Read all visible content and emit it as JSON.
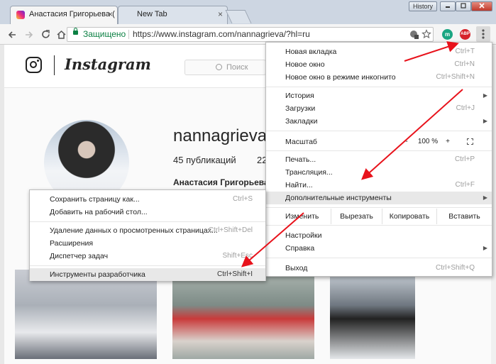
{
  "browser": {
    "tabs": [
      {
        "label": "Анастасия Григорьева (",
        "close": "×"
      },
      {
        "label": "New Tab",
        "close": "×"
      }
    ],
    "window_buttons": {
      "history": "History"
    },
    "address": {
      "secure_label": "Защищено",
      "url": "https://www.instagram.com/nannagrieva/?hl=ru"
    },
    "extensions": [
      {
        "name": "m-icon",
        "text": "m",
        "color": "#1aa682"
      },
      {
        "name": "adblock-icon",
        "text": "ABP",
        "color": "#d6222a"
      }
    ]
  },
  "instagram": {
    "wordmark": "Instagram",
    "search_placeholder": "Поиск",
    "username": "nannagrieva",
    "posts": "45 публикаций",
    "followers_partial": "22",
    "full_name": "Анастасия Григорьева"
  },
  "chrome_menu": {
    "items_top": [
      {
        "label": "Новая вкладка",
        "shortcut": "Ctrl+T"
      },
      {
        "label": "Новое окно",
        "shortcut": "Ctrl+N"
      },
      {
        "label": "Новое окно в режиме инкогнито",
        "shortcut": "Ctrl+Shift+N"
      }
    ],
    "items_history": [
      {
        "label": "История",
        "arrow": "▶"
      },
      {
        "label": "Загрузки",
        "shortcut": "Ctrl+J"
      },
      {
        "label": "Закладки",
        "arrow": "▶"
      }
    ],
    "zoom": {
      "label": "Масштаб",
      "minus": "-",
      "value": "100 %",
      "plus": "+"
    },
    "items_tools": [
      {
        "label": "Печать...",
        "shortcut": "Ctrl+P"
      },
      {
        "label": "Трансляция..."
      },
      {
        "label": "Найти...",
        "shortcut": "Ctrl+F"
      },
      {
        "label": "Дополнительные инструменты",
        "arrow": "▶"
      }
    ],
    "edit": {
      "label": "Изменить",
      "cut": "Вырезать",
      "copy": "Копировать",
      "paste": "Вставить"
    },
    "items_bottom": [
      {
        "label": "Настройки"
      },
      {
        "label": "Справка",
        "arrow": "▶"
      }
    ],
    "exit": {
      "label": "Выход",
      "shortcut": "Ctrl+Shift+Q"
    }
  },
  "submenu": {
    "group1": [
      {
        "label": "Сохранить страницу как...",
        "shortcut": "Ctrl+S"
      },
      {
        "label": "Добавить на рабочий стол..."
      }
    ],
    "group2": [
      {
        "label": "Удаление данных о просмотренных страницах...",
        "shortcut": "Ctrl+Shift+Del"
      },
      {
        "label": "Расширения"
      },
      {
        "label": "Диспетчер задач",
        "shortcut": "Shift+Esc"
      }
    ],
    "devtools": {
      "label": "Инструменты разработчика",
      "shortcut": "Ctrl+Shift+I"
    }
  },
  "colors": {
    "annotation_arrow": "#e8121b",
    "secure_green": "#0b8043"
  }
}
